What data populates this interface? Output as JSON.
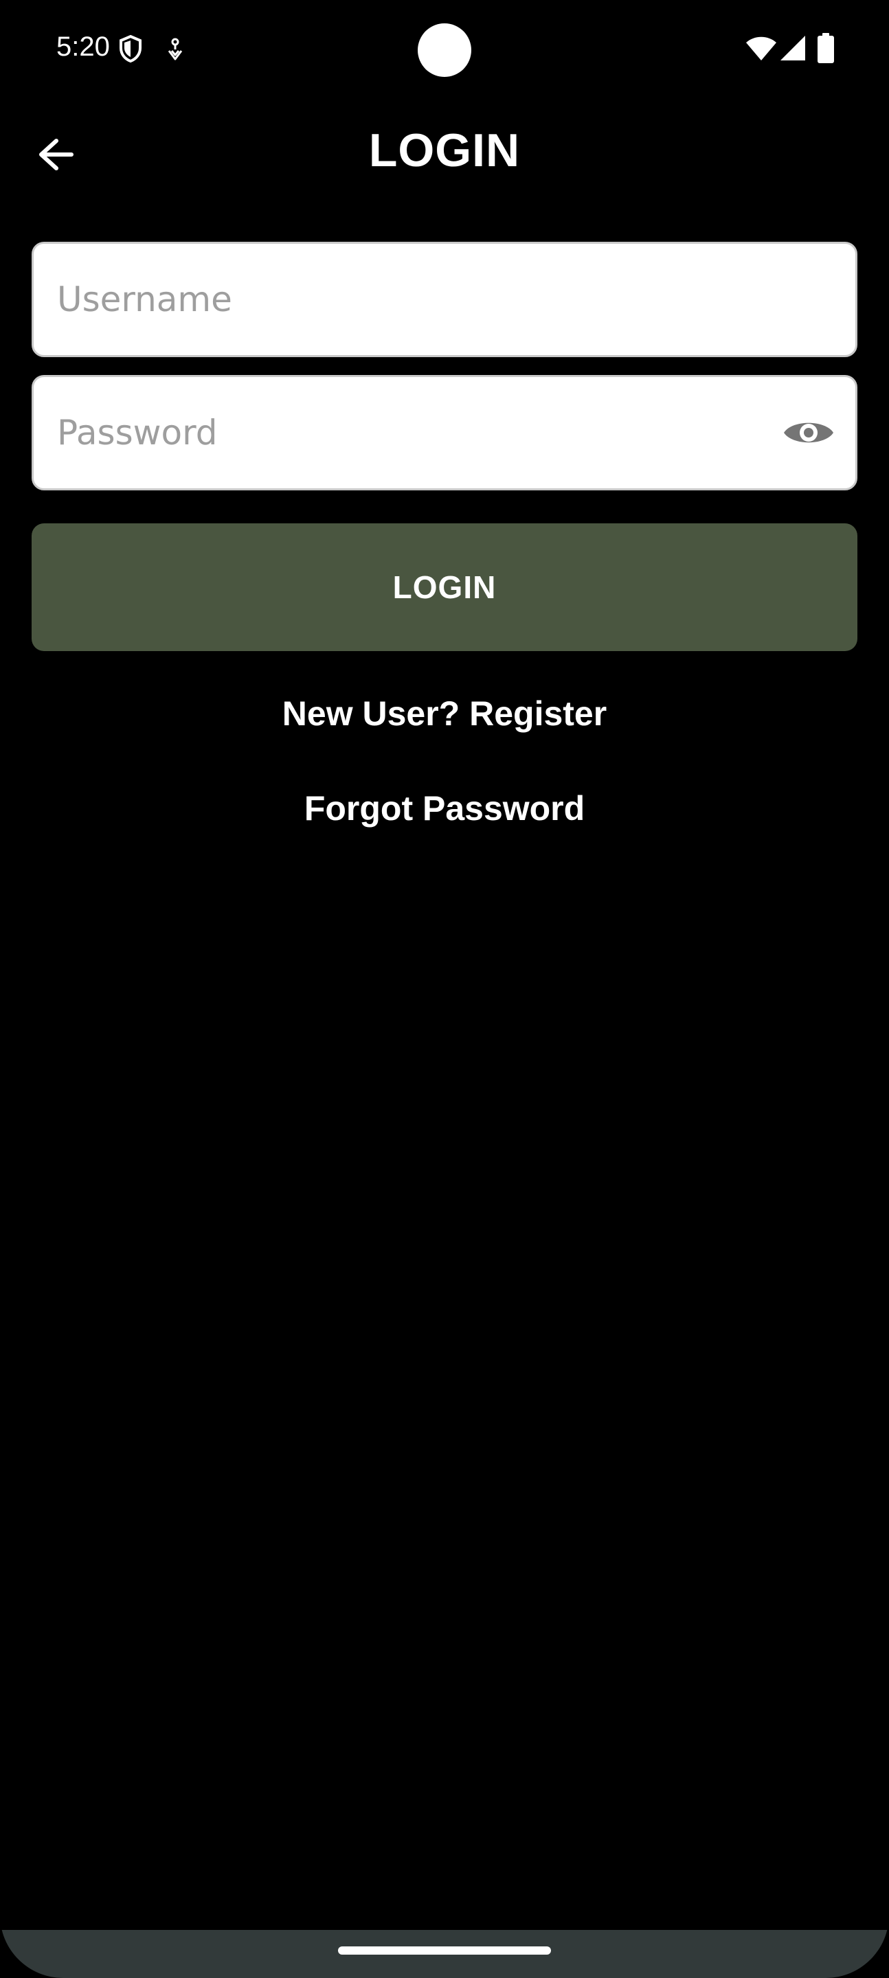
{
  "status_bar": {
    "time": "5:20",
    "icons": [
      "shield-icon",
      "notification-icon",
      "wifi-icon",
      "signal-icon",
      "battery-icon"
    ]
  },
  "app_bar": {
    "title": "LOGIN",
    "back_icon": "arrow-left-icon"
  },
  "form": {
    "username": {
      "placeholder": "Username",
      "value": ""
    },
    "password": {
      "placeholder": "Password",
      "value": "",
      "toggle_icon": "eye-icon"
    },
    "login_button_label": "LOGIN"
  },
  "links": {
    "register": "New User? Register",
    "forgot_password": "Forgot Password"
  },
  "colors": {
    "background": "#000000",
    "primary_button": "#4a5640",
    "text": "#ffffff",
    "placeholder": "#9e9e9e",
    "nav_bar": "#323a3a"
  }
}
